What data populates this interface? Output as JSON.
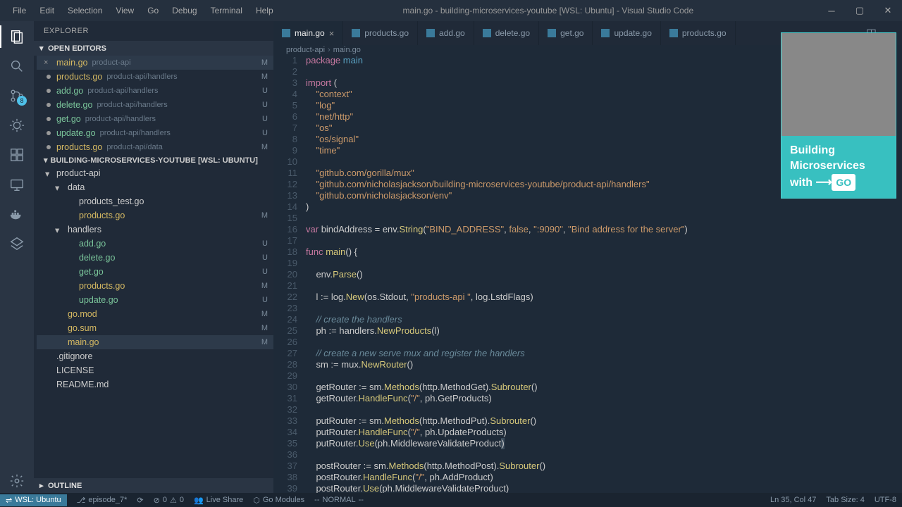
{
  "window": {
    "title": "main.go - building-microservices-youtube [WSL: Ubuntu] - Visual Studio Code"
  },
  "menu": [
    "File",
    "Edit",
    "Selection",
    "View",
    "Go",
    "Debug",
    "Terminal",
    "Help"
  ],
  "explorer": {
    "title": "EXPLORER",
    "openEditors": "OPEN EDITORS",
    "workspace": "BUILDING-MICROSERVICES-YOUTUBE [WSL: UBUNTU]",
    "outline": "OUTLINE"
  },
  "openEditors": [
    {
      "name": "main.go",
      "path": "product-api",
      "status": "M",
      "active": true
    },
    {
      "name": "products.go",
      "path": "product-api/handlers",
      "status": "M"
    },
    {
      "name": "add.go",
      "path": "product-api/handlers",
      "status": "U"
    },
    {
      "name": "delete.go",
      "path": "product-api/handlers",
      "status": "U"
    },
    {
      "name": "get.go",
      "path": "product-api/handlers",
      "status": "U"
    },
    {
      "name": "update.go",
      "path": "product-api/handlers",
      "status": "U"
    },
    {
      "name": "products.go",
      "path": "product-api/data",
      "status": "M"
    }
  ],
  "tree": [
    {
      "type": "folder",
      "name": "product-api",
      "depth": 1
    },
    {
      "type": "folder",
      "name": "data",
      "depth": 2
    },
    {
      "type": "file",
      "name": "products_test.go",
      "depth": 3,
      "status": ""
    },
    {
      "type": "file",
      "name": "products.go",
      "depth": 3,
      "status": "M",
      "gitm": true
    },
    {
      "type": "folder",
      "name": "handlers",
      "depth": 2
    },
    {
      "type": "file",
      "name": "add.go",
      "depth": 3,
      "status": "U",
      "gitu": true
    },
    {
      "type": "file",
      "name": "delete.go",
      "depth": 3,
      "status": "U",
      "gitu": true
    },
    {
      "type": "file",
      "name": "get.go",
      "depth": 3,
      "status": "U",
      "gitu": true
    },
    {
      "type": "file",
      "name": "products.go",
      "depth": 3,
      "status": "M",
      "gitm": true
    },
    {
      "type": "file",
      "name": "update.go",
      "depth": 3,
      "status": "U",
      "gitu": true
    },
    {
      "type": "file",
      "name": "go.mod",
      "depth": 2,
      "status": "M",
      "gitm": true
    },
    {
      "type": "file",
      "name": "go.sum",
      "depth": 2,
      "status": "M",
      "gitm": true
    },
    {
      "type": "file",
      "name": "main.go",
      "depth": 2,
      "status": "M",
      "gitm": true,
      "active": true
    },
    {
      "type": "file",
      "name": ".gitignore",
      "depth": 1,
      "status": ""
    },
    {
      "type": "file",
      "name": "LICENSE",
      "depth": 1,
      "status": ""
    },
    {
      "type": "file",
      "name": "README.md",
      "depth": 1,
      "status": ""
    }
  ],
  "tabs": [
    {
      "name": "main.go",
      "active": true
    },
    {
      "name": "products.go"
    },
    {
      "name": "add.go"
    },
    {
      "name": "delete.go"
    },
    {
      "name": "get.go"
    },
    {
      "name": "update.go"
    },
    {
      "name": "products.go"
    }
  ],
  "breadcrumb": {
    "a": "product-api",
    "b": "main.go"
  },
  "code": {
    "startLine": 1,
    "lines": [
      {
        "n": 1,
        "h": "<span class='k'>package</span> <span class='t'>main</span>"
      },
      {
        "n": 2,
        "h": ""
      },
      {
        "n": 3,
        "h": "<span class='k'>import</span> <span class='p'>(</span>"
      },
      {
        "n": 4,
        "h": "    <span class='s'>\"</span><span class='s'>context</span><span class='s'>\"</span>"
      },
      {
        "n": 5,
        "h": "    <span class='s'>\"</span><span class='s'>log</span><span class='s'>\"</span>"
      },
      {
        "n": 6,
        "h": "    <span class='s'>\"</span><span class='s'>net/http</span><span class='s'>\"</span>"
      },
      {
        "n": 7,
        "h": "    <span class='s'>\"</span><span class='s'>os</span><span class='s'>\"</span>"
      },
      {
        "n": 8,
        "h": "    <span class='s'>\"</span><span class='s'>os/signal</span><span class='s'>\"</span>"
      },
      {
        "n": 9,
        "h": "    <span class='s'>\"</span><span class='s'>time</span><span class='s'>\"</span>"
      },
      {
        "n": 10,
        "h": ""
      },
      {
        "n": 11,
        "h": "    <span class='s'>\"</span><span class='s'>github.com/gorilla/mux</span><span class='s'>\"</span>"
      },
      {
        "n": 12,
        "h": "    <span class='s'>\"</span><span class='s'>github.com/nicholasjackson/building-microservices-youtube/product-api/handlers</span><span class='s'>\"</span>"
      },
      {
        "n": 13,
        "h": "    <span class='s'>\"</span><span class='s'>github.com/nicholasjackson/env</span><span class='s'>\"</span>"
      },
      {
        "n": 14,
        "h": "<span class='p'>)</span>"
      },
      {
        "n": 15,
        "h": ""
      },
      {
        "n": 16,
        "h": "<span class='k'>var</span> <span class='v'>bindAddress</span> <span class='p'>=</span> <span class='v'>env</span><span class='p'>.</span><span class='f'>String</span><span class='p'>(</span><span class='s'>\"BIND_ADDRESS\"</span><span class='p'>,</span> <span class='n'>false</span><span class='p'>,</span> <span class='s'>\":9090\"</span><span class='p'>,</span> <span class='s'>\"Bind address for the server\"</span><span class='p'>)</span>"
      },
      {
        "n": 17,
        "h": ""
      },
      {
        "n": 18,
        "h": "<span class='k'>func</span> <span class='f'>main</span><span class='p'>() {</span>"
      },
      {
        "n": 19,
        "h": ""
      },
      {
        "n": 20,
        "h": "    <span class='v'>env</span><span class='p'>.</span><span class='f'>Parse</span><span class='p'>()</span>"
      },
      {
        "n": 21,
        "h": ""
      },
      {
        "n": 22,
        "h": "    <span class='v'>l</span> <span class='p'>:=</span> <span class='v'>log</span><span class='p'>.</span><span class='f'>New</span><span class='p'>(</span><span class='v'>os</span><span class='p'>.</span><span class='v'>Stdout</span><span class='p'>,</span> <span class='s'>\"products-api \"</span><span class='p'>,</span> <span class='v'>log</span><span class='p'>.</span><span class='v'>LstdFlags</span><span class='p'>)</span>"
      },
      {
        "n": 23,
        "h": ""
      },
      {
        "n": 24,
        "h": "    <span class='c'>// create the handlers</span>"
      },
      {
        "n": 25,
        "h": "    <span class='v'>ph</span> <span class='p'>:=</span> <span class='v'>handlers</span><span class='p'>.</span><span class='f'>NewProducts</span><span class='p'>(</span><span class='v'>l</span><span class='p'>)</span>"
      },
      {
        "n": 26,
        "h": ""
      },
      {
        "n": 27,
        "h": "    <span class='c'>// create a new serve mux and register the handlers</span>"
      },
      {
        "n": 28,
        "h": "    <span class='v'>sm</span> <span class='p'>:=</span> <span class='v'>mux</span><span class='p'>.</span><span class='f'>NewRouter</span><span class='p'>()</span>"
      },
      {
        "n": 29,
        "h": ""
      },
      {
        "n": 30,
        "h": "    <span class='v'>getRouter</span> <span class='p'>:=</span> <span class='v'>sm</span><span class='p'>.</span><span class='f'>Methods</span><span class='p'>(</span><span class='v'>http</span><span class='p'>.</span><span class='v'>MethodGet</span><span class='p'>).</span><span class='f'>Subrouter</span><span class='p'>()</span>"
      },
      {
        "n": 31,
        "h": "    <span class='v'>getRouter</span><span class='p'>.</span><span class='f'>HandleFunc</span><span class='p'>(</span><span class='s'>\"/\"</span><span class='p'>,</span> <span class='v'>ph</span><span class='p'>.</span><span class='v'>GetProducts</span><span class='p'>)</span>"
      },
      {
        "n": 32,
        "h": ""
      },
      {
        "n": 33,
        "h": "    <span class='v'>putRouter</span> <span class='p'>:=</span> <span class='v'>sm</span><span class='p'>.</span><span class='f'>Methods</span><span class='p'>(</span><span class='v'>http</span><span class='p'>.</span><span class='v'>MethodPut</span><span class='p'>).</span><span class='f'>Subrouter</span><span class='p'>()</span>"
      },
      {
        "n": 34,
        "h": "    <span class='v'>putRouter</span><span class='p'>.</span><span class='f'>HandleFunc</span><span class='p'>(</span><span class='s'>\"/\"</span><span class='p'>,</span> <span class='v'>ph</span><span class='p'>.</span><span class='v'>UpdateProducts</span><span class='p'>)</span>"
      },
      {
        "n": 35,
        "h": "    <span class='v'>putRouter</span><span class='p'>.</span><span class='f'>Use</span><span class='p'>(</span><span class='v'>ph</span><span class='p'>.</span><span class='v'>MiddlewareValidateProduct</span><span class='cursor-hl'>)</span>"
      },
      {
        "n": 36,
        "h": ""
      },
      {
        "n": 37,
        "h": "    <span class='v'>postRouter</span> <span class='p'>:=</span> <span class='v'>sm</span><span class='p'>.</span><span class='f'>Methods</span><span class='p'>(</span><span class='v'>http</span><span class='p'>.</span><span class='v'>MethodPost</span><span class='p'>).</span><span class='f'>Subrouter</span><span class='p'>()</span>"
      },
      {
        "n": 38,
        "h": "    <span class='v'>postRouter</span><span class='p'>.</span><span class='f'>HandleFunc</span><span class='p'>(</span><span class='s'>\"/\"</span><span class='p'>,</span> <span class='v'>ph</span><span class='p'>.</span><span class='v'>AddProduct</span><span class='p'>)</span>"
      },
      {
        "n": 39,
        "h": "    <span class='v'>postRouter</span><span class='p'>.</span><span class='f'>Use</span><span class='p'>(</span><span class='v'>ph</span><span class='p'>.</span><span class='v'>MiddlewareValidateProduct</span><span class='p'>)</span>"
      }
    ]
  },
  "statusbar": {
    "remote": "WSL: Ubuntu",
    "branch": "episode_7*",
    "sync": "",
    "errors": "0",
    "warnings": "0",
    "liveshare": "Live Share",
    "gomodules": "Go Modules",
    "mode": "NORMAL",
    "pos": "Ln 35, Col 47",
    "tabsize": "Tab Size: 4",
    "encoding": "UTF-8"
  },
  "overlay": {
    "l1": "Building",
    "l2": "Microservices",
    "l3": "with",
    "go": "GO"
  },
  "scm_badge": "8"
}
